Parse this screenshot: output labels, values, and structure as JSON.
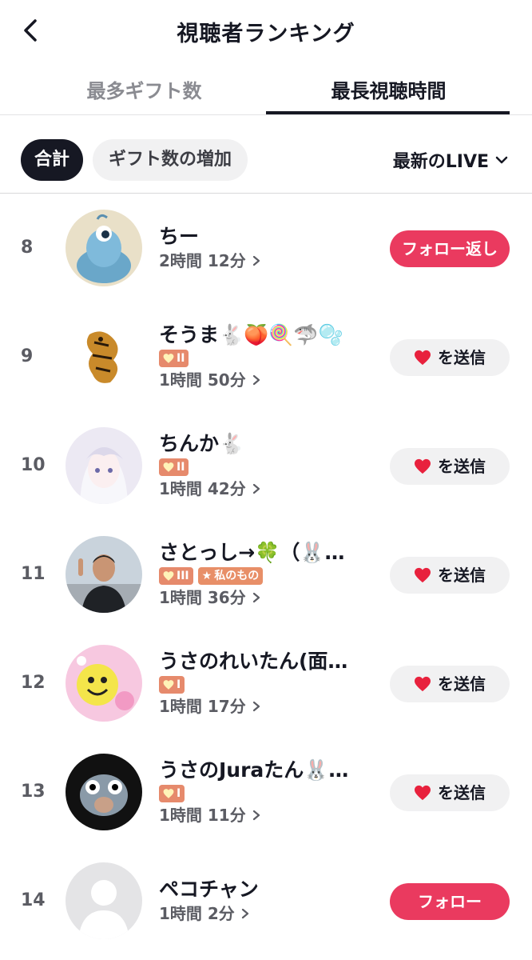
{
  "header": {
    "title": "視聴者ランキング",
    "back_icon": "chevron-left-icon"
  },
  "tabs": [
    {
      "label": "最多ギフト数",
      "active": false
    },
    {
      "label": "最長視聴時間",
      "active": true
    }
  ],
  "filters": {
    "chips": [
      {
        "label": "合計",
        "selected": true
      },
      {
        "label": "ギフト数の増加",
        "selected": false
      }
    ],
    "live_select": "最新のLIVE"
  },
  "colors": {
    "accent": "#ea3a5f",
    "badge": "#e68a6c",
    "text": "#161823"
  },
  "viewers": [
    {
      "rank": "8",
      "name": "ちー",
      "badges": [],
      "duration": "2時間 12分",
      "action": "フォロー返し",
      "action_type": "follow"
    },
    {
      "rank": "9",
      "name": "そうま🐇🍑🍭🦈🫧",
      "badges": [
        {
          "type": "lv",
          "label": "II"
        }
      ],
      "duration": "1時間 50分",
      "action": "を送信",
      "action_type": "send"
    },
    {
      "rank": "10",
      "name": "ちんか🐇",
      "badges": [
        {
          "type": "lv",
          "label": "II"
        }
      ],
      "duration": "1時間 42分",
      "action": "を送信",
      "action_type": "send"
    },
    {
      "rank": "11",
      "name": "さとっし→🍀（🐰…",
      "badges": [
        {
          "type": "lv",
          "label": "III"
        },
        {
          "type": "tag",
          "label": "私のもの"
        }
      ],
      "duration": "1時間 36分",
      "action": "を送信",
      "action_type": "send"
    },
    {
      "rank": "12",
      "name": "うさのれいたん(面…",
      "badges": [
        {
          "type": "lv",
          "label": "I"
        }
      ],
      "duration": "1時間 17分",
      "action": "を送信",
      "action_type": "send"
    },
    {
      "rank": "13",
      "name": "うさのJuraたん🐰…",
      "badges": [
        {
          "type": "lv",
          "label": "I"
        }
      ],
      "duration": "1時間 11分",
      "action": "を送信",
      "action_type": "send"
    },
    {
      "rank": "14",
      "name": "ペコチャン",
      "badges": [],
      "duration": "1時間 2分",
      "action": "フォロー",
      "action_type": "follow"
    }
  ]
}
